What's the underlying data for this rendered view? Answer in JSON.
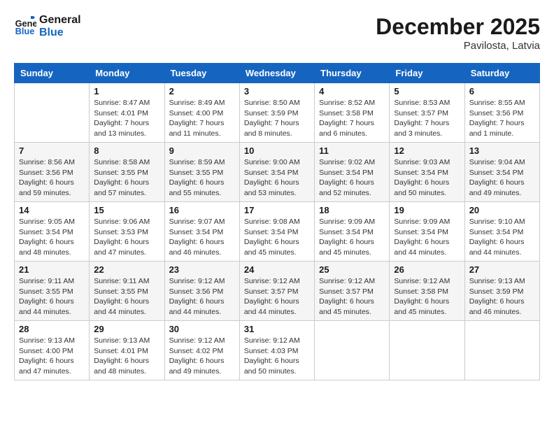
{
  "header": {
    "logo_line1": "General",
    "logo_line2": "Blue",
    "month": "December 2025",
    "location": "Pavilosta, Latvia"
  },
  "weekdays": [
    "Sunday",
    "Monday",
    "Tuesday",
    "Wednesday",
    "Thursday",
    "Friday",
    "Saturday"
  ],
  "weeks": [
    [
      {
        "day": "",
        "text": ""
      },
      {
        "day": "1",
        "text": "Sunrise: 8:47 AM\nSunset: 4:01 PM\nDaylight: 7 hours\nand 13 minutes."
      },
      {
        "day": "2",
        "text": "Sunrise: 8:49 AM\nSunset: 4:00 PM\nDaylight: 7 hours\nand 11 minutes."
      },
      {
        "day": "3",
        "text": "Sunrise: 8:50 AM\nSunset: 3:59 PM\nDaylight: 7 hours\nand 8 minutes."
      },
      {
        "day": "4",
        "text": "Sunrise: 8:52 AM\nSunset: 3:58 PM\nDaylight: 7 hours\nand 6 minutes."
      },
      {
        "day": "5",
        "text": "Sunrise: 8:53 AM\nSunset: 3:57 PM\nDaylight: 7 hours\nand 3 minutes."
      },
      {
        "day": "6",
        "text": "Sunrise: 8:55 AM\nSunset: 3:56 PM\nDaylight: 7 hours\nand 1 minute."
      }
    ],
    [
      {
        "day": "7",
        "text": "Sunrise: 8:56 AM\nSunset: 3:56 PM\nDaylight: 6 hours\nand 59 minutes."
      },
      {
        "day": "8",
        "text": "Sunrise: 8:58 AM\nSunset: 3:55 PM\nDaylight: 6 hours\nand 57 minutes."
      },
      {
        "day": "9",
        "text": "Sunrise: 8:59 AM\nSunset: 3:55 PM\nDaylight: 6 hours\nand 55 minutes."
      },
      {
        "day": "10",
        "text": "Sunrise: 9:00 AM\nSunset: 3:54 PM\nDaylight: 6 hours\nand 53 minutes."
      },
      {
        "day": "11",
        "text": "Sunrise: 9:02 AM\nSunset: 3:54 PM\nDaylight: 6 hours\nand 52 minutes."
      },
      {
        "day": "12",
        "text": "Sunrise: 9:03 AM\nSunset: 3:54 PM\nDaylight: 6 hours\nand 50 minutes."
      },
      {
        "day": "13",
        "text": "Sunrise: 9:04 AM\nSunset: 3:54 PM\nDaylight: 6 hours\nand 49 minutes."
      }
    ],
    [
      {
        "day": "14",
        "text": "Sunrise: 9:05 AM\nSunset: 3:54 PM\nDaylight: 6 hours\nand 48 minutes."
      },
      {
        "day": "15",
        "text": "Sunrise: 9:06 AM\nSunset: 3:53 PM\nDaylight: 6 hours\nand 47 minutes."
      },
      {
        "day": "16",
        "text": "Sunrise: 9:07 AM\nSunset: 3:54 PM\nDaylight: 6 hours\nand 46 minutes."
      },
      {
        "day": "17",
        "text": "Sunrise: 9:08 AM\nSunset: 3:54 PM\nDaylight: 6 hours\nand 45 minutes."
      },
      {
        "day": "18",
        "text": "Sunrise: 9:09 AM\nSunset: 3:54 PM\nDaylight: 6 hours\nand 45 minutes."
      },
      {
        "day": "19",
        "text": "Sunrise: 9:09 AM\nSunset: 3:54 PM\nDaylight: 6 hours\nand 44 minutes."
      },
      {
        "day": "20",
        "text": "Sunrise: 9:10 AM\nSunset: 3:54 PM\nDaylight: 6 hours\nand 44 minutes."
      }
    ],
    [
      {
        "day": "21",
        "text": "Sunrise: 9:11 AM\nSunset: 3:55 PM\nDaylight: 6 hours\nand 44 minutes."
      },
      {
        "day": "22",
        "text": "Sunrise: 9:11 AM\nSunset: 3:55 PM\nDaylight: 6 hours\nand 44 minutes."
      },
      {
        "day": "23",
        "text": "Sunrise: 9:12 AM\nSunset: 3:56 PM\nDaylight: 6 hours\nand 44 minutes."
      },
      {
        "day": "24",
        "text": "Sunrise: 9:12 AM\nSunset: 3:57 PM\nDaylight: 6 hours\nand 44 minutes."
      },
      {
        "day": "25",
        "text": "Sunrise: 9:12 AM\nSunset: 3:57 PM\nDaylight: 6 hours\nand 45 minutes."
      },
      {
        "day": "26",
        "text": "Sunrise: 9:12 AM\nSunset: 3:58 PM\nDaylight: 6 hours\nand 45 minutes."
      },
      {
        "day": "27",
        "text": "Sunrise: 9:13 AM\nSunset: 3:59 PM\nDaylight: 6 hours\nand 46 minutes."
      }
    ],
    [
      {
        "day": "28",
        "text": "Sunrise: 9:13 AM\nSunset: 4:00 PM\nDaylight: 6 hours\nand 47 minutes."
      },
      {
        "day": "29",
        "text": "Sunrise: 9:13 AM\nSunset: 4:01 PM\nDaylight: 6 hours\nand 48 minutes."
      },
      {
        "day": "30",
        "text": "Sunrise: 9:12 AM\nSunset: 4:02 PM\nDaylight: 6 hours\nand 49 minutes."
      },
      {
        "day": "31",
        "text": "Sunrise: 9:12 AM\nSunset: 4:03 PM\nDaylight: 6 hours\nand 50 minutes."
      },
      {
        "day": "",
        "text": ""
      },
      {
        "day": "",
        "text": ""
      },
      {
        "day": "",
        "text": ""
      }
    ]
  ]
}
